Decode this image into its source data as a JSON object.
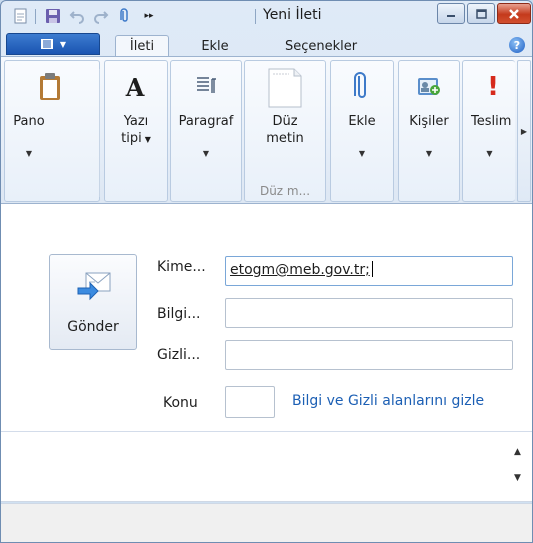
{
  "window": {
    "title": "Yeni İleti",
    "overflow_glyph": "▸▸"
  },
  "tabs": {
    "file_icon": "menu-icon",
    "items": [
      {
        "label": "İleti",
        "active": true
      },
      {
        "label": "Ekle",
        "active": false
      },
      {
        "label": "Seçenekler",
        "active": false
      }
    ],
    "help_glyph": "?"
  },
  "ribbon": {
    "pano": {
      "label": "Pano",
      "icon": "clipboard-icon"
    },
    "font": {
      "label": "Yazı\ntipi",
      "arrow": "▼",
      "icon": "font-icon"
    },
    "paragraph": {
      "label": "Paragraf",
      "icon": "paragraph-icon"
    },
    "plain": {
      "label": "Düz\nmetin",
      "icon": "plain-text-icon",
      "group_label": "Düz m..."
    },
    "attach": {
      "label": "Ekle",
      "icon": "paperclip-icon"
    },
    "people": {
      "label": "Kişiler",
      "icon": "contacts-icon"
    },
    "delivery": {
      "label": "Teslim",
      "icon": "exclamation-icon"
    },
    "arrow": "▼",
    "scroll_right": "▶"
  },
  "compose": {
    "send_label": "Gönder",
    "to_label": "Kime...",
    "to_value": "etogm@meb.gov.tr;",
    "cc_label": "Bilgi...",
    "bcc_label": "Gizli...",
    "subject_label": "Konu",
    "hide_link": "Bilgi ve Gizli alanlarını gizle"
  },
  "scroll": {
    "up": "▲",
    "down": "▼"
  },
  "colors": {
    "accent": "#1a54b1",
    "link": "#1c5fb4",
    "close": "#c43a1c"
  }
}
